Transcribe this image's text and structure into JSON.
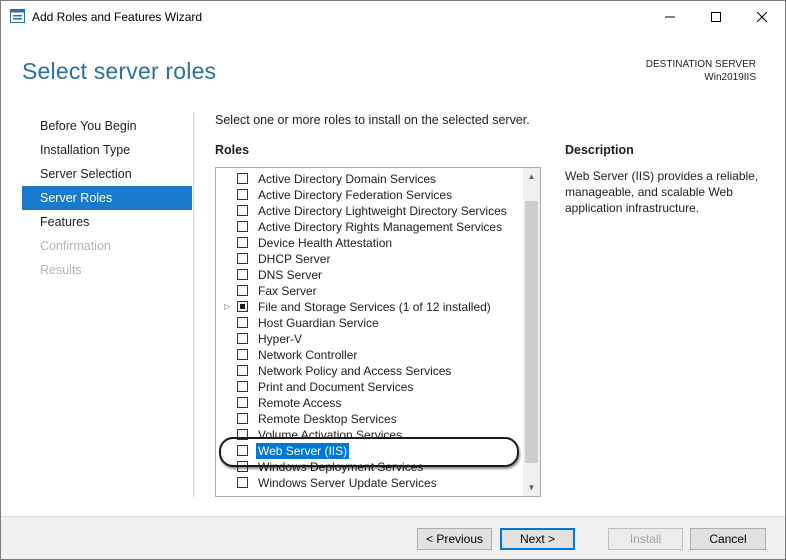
{
  "window": {
    "title": "Add Roles and Features Wizard",
    "minimize_glyph": "—",
    "maximize_glyph": "☐",
    "close_glyph": "✕"
  },
  "header": {
    "page_title": "Select server roles",
    "destination_label": "DESTINATION SERVER",
    "destination_server": "Win2019IIS"
  },
  "nav": {
    "items": [
      {
        "label": "Before You Begin",
        "state": "normal"
      },
      {
        "label": "Installation Type",
        "state": "normal"
      },
      {
        "label": "Server Selection",
        "state": "normal"
      },
      {
        "label": "Server Roles",
        "state": "active"
      },
      {
        "label": "Features",
        "state": "normal"
      },
      {
        "label": "Confirmation",
        "state": "disabled"
      },
      {
        "label": "Results",
        "state": "disabled"
      }
    ]
  },
  "main": {
    "instruction": "Select one or more roles to install on the selected server.",
    "roles_label": "Roles",
    "description_label": "Description",
    "description_text": "Web Server (IIS) provides a reliable, manageable, and scalable Web application infrastructure.",
    "roles": [
      {
        "label": "Active Directory Domain Services",
        "checked": false
      },
      {
        "label": "Active Directory Federation Services",
        "checked": false
      },
      {
        "label": "Active Directory Lightweight Directory Services",
        "checked": false
      },
      {
        "label": "Active Directory Rights Management Services",
        "checked": false
      },
      {
        "label": "Device Health Attestation",
        "checked": false
      },
      {
        "label": "DHCP Server",
        "checked": false
      },
      {
        "label": "DNS Server",
        "checked": false
      },
      {
        "label": "Fax Server",
        "checked": false
      },
      {
        "label": "File and Storage Services (1 of 12 installed)",
        "checked": "partial",
        "expandable": true
      },
      {
        "label": "Host Guardian Service",
        "checked": false
      },
      {
        "label": "Hyper-V",
        "checked": false
      },
      {
        "label": "Network Controller",
        "checked": false
      },
      {
        "label": "Network Policy and Access Services",
        "checked": false
      },
      {
        "label": "Print and Document Services",
        "checked": false
      },
      {
        "label": "Remote Access",
        "checked": false
      },
      {
        "label": "Remote Desktop Services",
        "checked": false
      },
      {
        "label": "Volume Activation Services",
        "checked": false
      },
      {
        "label": "Web Server (IIS)",
        "checked": false,
        "selected": true
      },
      {
        "label": "Windows Deployment Services",
        "checked": false
      },
      {
        "label": "Windows Server Update Services",
        "checked": false
      }
    ]
  },
  "footer": {
    "previous_label": "< Previous",
    "next_label": "Next >",
    "install_label": "Install",
    "cancel_label": "Cancel"
  },
  "colors": {
    "accent": "#1979ca",
    "title_blue": "#2a6f9e",
    "selection": "#0078d7"
  }
}
